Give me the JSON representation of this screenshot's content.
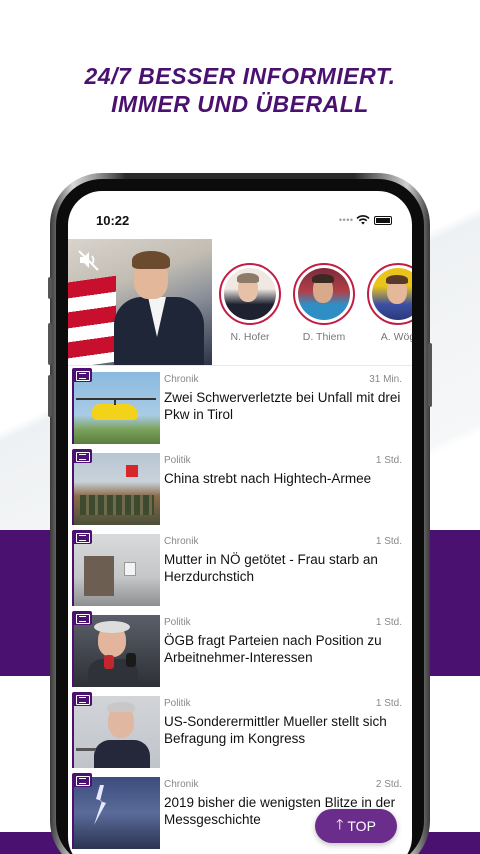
{
  "headline": {
    "line1": "24/7 BESSER INFORMIERT.",
    "line2": "IMMER UND ÜBERALL"
  },
  "status_bar": {
    "time": "10:22"
  },
  "stories": [
    {
      "name": "N. Hofer"
    },
    {
      "name": "D. Thiem"
    },
    {
      "name": "A. Wög"
    }
  ],
  "news": [
    {
      "category": "Chronik",
      "time": "31 Min.",
      "title": "Zwei Schwerverletzte bei Unfall mit drei Pkw in Tirol"
    },
    {
      "category": "Politik",
      "time": "1 Std.",
      "title": "China strebt nach Hightech-Armee"
    },
    {
      "category": "Chronik",
      "time": "1 Std.",
      "title": "Mutter in NÖ getötet - Frau starb an Herzdurchstich"
    },
    {
      "category": "Politik",
      "time": "1 Std.",
      "title": "ÖGB fragt Parteien nach Position zu Arbeitnehmer-Interessen"
    },
    {
      "category": "Politik",
      "time": "1 Std.",
      "title": "US-Sonderermittler Mueller stellt sich Befragung im Kongress"
    },
    {
      "category": "Chronik",
      "time": "2 Std.",
      "title": "2019 bisher die wenigsten Blitze in der Messgeschichte"
    }
  ],
  "top_button": {
    "label": "TOP"
  },
  "colors": {
    "brand_purple": "#4a1170",
    "story_ring": "#c21d45"
  }
}
